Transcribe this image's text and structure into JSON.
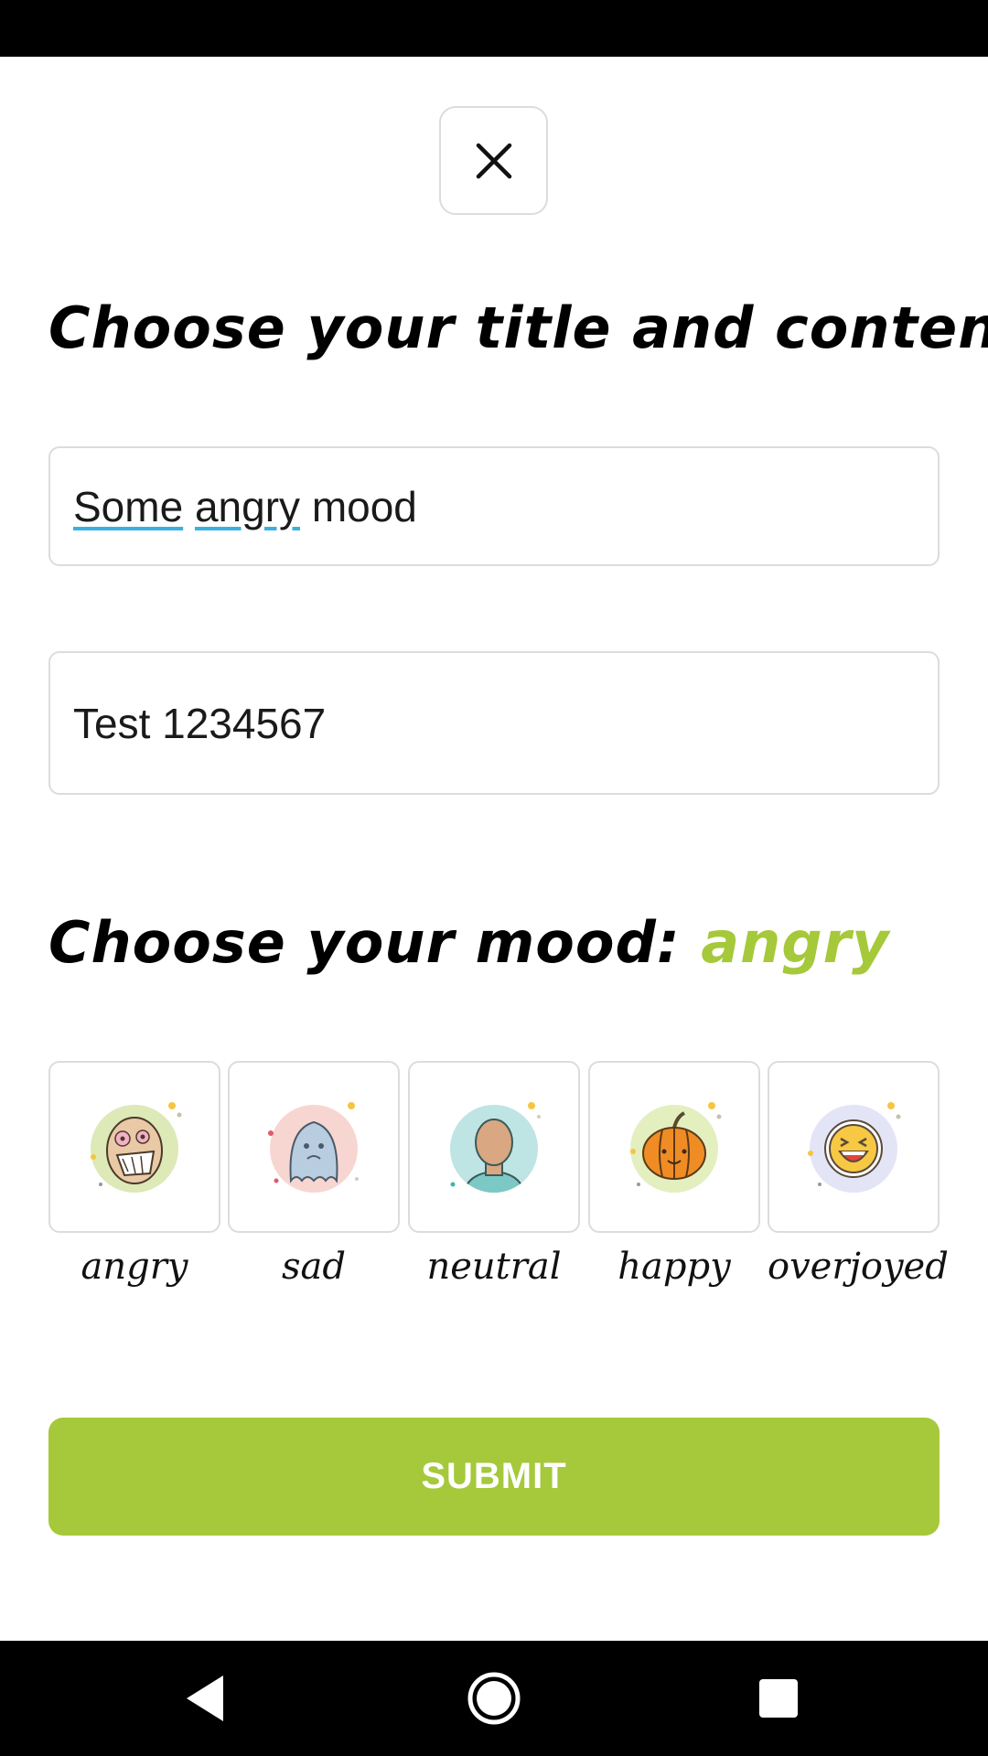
{
  "screen": {
    "heading_title": "Choose your title and content",
    "title_value_words": [
      "Some",
      "angry",
      "mood"
    ],
    "content_value": "Test 1234567",
    "mood_heading": "Choose your mood:",
    "selected_mood": "angry",
    "submit_label": "SUBMIT",
    "accent_color": "#a5c93a"
  },
  "moods": [
    {
      "label": "angry",
      "icon": "angry-face-icon"
    },
    {
      "label": "sad",
      "icon": "ghost-icon"
    },
    {
      "label": "neutral",
      "icon": "person-avatar-icon"
    },
    {
      "label": "happy",
      "icon": "pumpkin-icon"
    },
    {
      "label": "overjoyed",
      "icon": "laughing-face-icon"
    }
  ],
  "system_nav": {
    "back_icon": "back-triangle-icon",
    "home_icon": "home-circle-icon",
    "recents_icon": "recents-square-icon"
  }
}
